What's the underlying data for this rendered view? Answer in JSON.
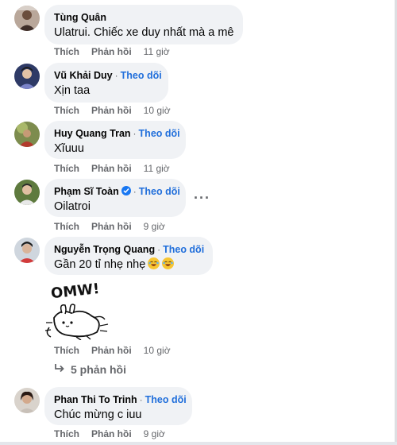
{
  "comments": [
    {
      "name": "Tùng Quân",
      "follow": "",
      "text": "Ulatrui. Chiếc xe duy nhất mà a mê",
      "like": "Thích",
      "reply": "Phản hồi",
      "time": "11 giờ"
    },
    {
      "name": "Vũ Khải Duy",
      "follow": "Theo dõi",
      "text": "Xịn taa",
      "like": "Thích",
      "reply": "Phản hồi",
      "time": "10 giờ"
    },
    {
      "name": "Huy Quang Tran",
      "follow": "Theo dõi",
      "text": "Xĩuuu",
      "like": "Thích",
      "reply": "Phản hồi",
      "time": "11 giờ"
    },
    {
      "name": "Phạm Sĩ Toàn",
      "follow": "Theo dõi",
      "text": "Oilatroi",
      "like": "Thích",
      "reply": "Phản hồi",
      "time": "9 giờ"
    },
    {
      "name": "Nguyễn Trọng Quang",
      "follow": "Theo dõi",
      "text": "Gần 20 tỉ nhẹ nhẹ",
      "like": "Thích",
      "reply": "Phản hồi",
      "time": "10 giờ",
      "sticker_text": "OMW!",
      "replies": "5 phản hồi"
    },
    {
      "name": "Phan Thi To Trinh",
      "follow": "Theo dõi",
      "text": "Chúc mừng c iuu",
      "like": "Thích",
      "reply": "Phản hồi",
      "time": "9 giờ"
    }
  ],
  "colors": {
    "bubble": "#f0f2f5",
    "follow": "#216fdb",
    "meta": "#65676b",
    "verified": "#1877f2"
  },
  "icons": {
    "verified": "verified-badge-icon",
    "more": "more-options-icon",
    "reply_arrow": "reply-arrow-icon",
    "emoji": "laughing-emoji-icon"
  }
}
